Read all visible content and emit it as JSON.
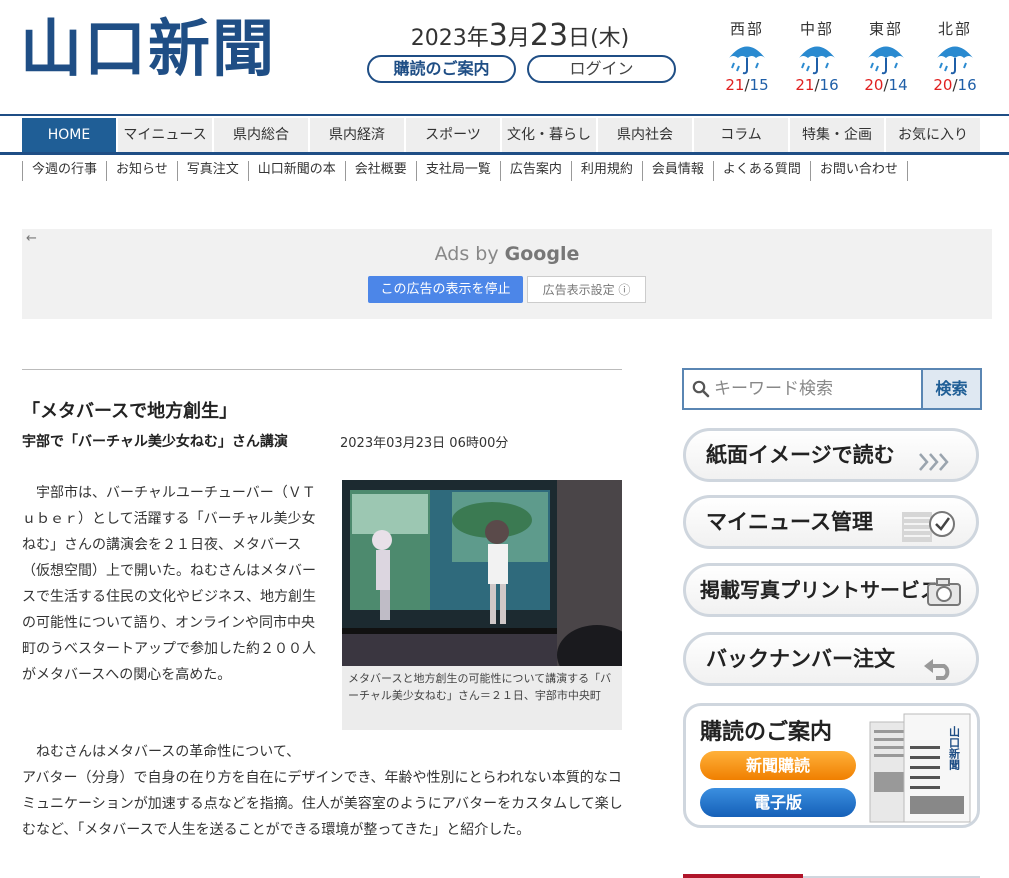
{
  "header": {
    "logo": "山口新聞",
    "date": {
      "year": "2023年",
      "month": "3",
      "month_suffix": "月",
      "day": "23",
      "day_suffix": "日",
      "weekday": "(木)"
    },
    "subscribe_button": "購読のご案内",
    "login_button": "ログイン"
  },
  "weather": [
    {
      "region": "西部",
      "hi": "21",
      "lo": "15",
      "icon": "umbrella-rain-icon"
    },
    {
      "region": "中部",
      "hi": "21",
      "lo": "16",
      "icon": "umbrella-rain-icon"
    },
    {
      "region": "東部",
      "hi": "20",
      "lo": "14",
      "icon": "umbrella-rain-icon"
    },
    {
      "region": "北部",
      "hi": "20",
      "lo": "16",
      "icon": "umbrella-rain-icon"
    }
  ],
  "weather_sep": "/",
  "nav": [
    "HOME",
    "マイニュース",
    "県内総合",
    "県内経済",
    "スポーツ",
    "文化・暮らし",
    "県内社会",
    "コラム",
    "特集・企画",
    "お気に入り"
  ],
  "subnav": [
    "今週の行事",
    "お知らせ",
    "写真注文",
    "山口新聞の本",
    "会社概要",
    "支社局一覧",
    "広告案内",
    "利用規約",
    "会員情報",
    "よくある質問",
    "お問い合わせ"
  ],
  "ad": {
    "arrow": "←",
    "ads_by": "Ads by ",
    "google": "Google",
    "stop": "この広告の表示を停止",
    "settings": "広告表示設定 ⓘ"
  },
  "article": {
    "title": "「メタバースで地方創生」",
    "subtitle": "宇部で「バーチャル美少女ねむ」さん講演",
    "datetime": "2023年03月23日 06時00分",
    "paragraph1": "　宇部市は、バーチャルユーチューバー（ＶＴｕｂｅｒ）として活躍する「バーチャル美少女ねむ」さんの講演会を２１日夜、メタバース（仮想空間）上で開いた。ねむさんはメタバースで生活する住民の文化やビジネス、地方創生の可能性について語り、オンラインや同市中央町のうべスタートアップで参加した約２００人がメタバースへの関心を高めた。",
    "paragraph2a": "　ねむさんはメタバースの革命性について、",
    "paragraph2b": "アバター（分身）で自身の在り方を自在にデザインでき、年齢や性別にとらわれない本質的なコミュニケーションが加速する点などを指摘。住人が美容室のようにアバターをカスタムして楽しむなど、「メタバースで人生を送ることができる環境が整ってきた」と紹介した。",
    "caption": "メタバースと地方創生の可能性について講演する「バーチャル美少女ねむ」さん＝２１日、宇部市中央町"
  },
  "sidebar": {
    "search_placeholder": "キーワード検索",
    "search_button": "検索",
    "buttons": [
      "紙面イメージで読む",
      "マイニュース管理",
      "掲載写真プリントサービス",
      "バックナンバー注文"
    ],
    "promo": {
      "title": "購読のご案内",
      "paper_button": "新聞購読",
      "digital_button": "電子版",
      "paper_logo": "山口新聞"
    }
  },
  "colors": {
    "brand": "#1f4e85",
    "hi_temp": "#e02020",
    "lo_temp": "#1f5fa8",
    "ad_button": "#4c86e8"
  }
}
